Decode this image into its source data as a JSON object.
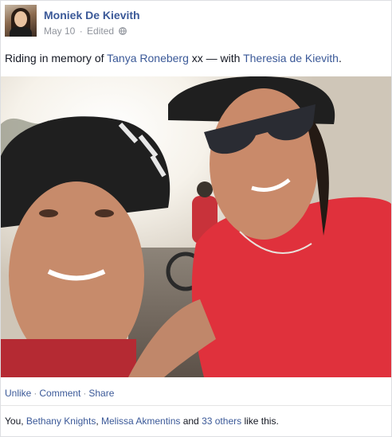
{
  "post": {
    "author": "Moniek De Kievith",
    "date": "May 10",
    "edited": "Edited",
    "separator": "·",
    "privacy_icon": "globe-icon",
    "text_prefix": "Riding in memory of ",
    "mention": "Tanya Roneberg",
    "text_middle": " xx — with ",
    "tagged": "Theresia de Kievith",
    "text_suffix": "."
  },
  "photo": {
    "subject": "selfie-two-cyclists-wearing-helmets-and-sunglasses",
    "colors": {
      "sky": "#f4efe6",
      "shirt": "#e0313c",
      "helmet": "#1f1f1f"
    }
  },
  "actions": {
    "unlike": "Unlike",
    "comment": "Comment",
    "share": "Share",
    "dot": "·"
  },
  "likes": {
    "you": "You, ",
    "friend1": "Bethany Knights",
    "comma": ", ",
    "friend2": "Melissa Akmentins",
    "and": " and ",
    "others": "33 others",
    "suffix": " like this."
  },
  "colors": {
    "link": "#3b5998",
    "meta": "#90949c"
  }
}
